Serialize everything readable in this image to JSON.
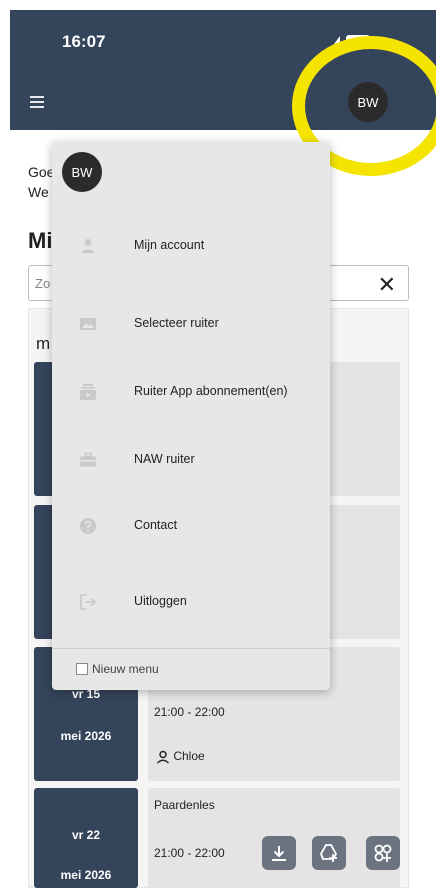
{
  "status_bar": {
    "time": "16:07"
  },
  "header": {
    "avatar_initials": "BW"
  },
  "page": {
    "greeting_line1": "Goe",
    "greeting_line2": "We",
    "title": "Mi",
    "search_placeholder": "Zo",
    "list_header": "m"
  },
  "lessons": [
    {
      "day": "vr 15",
      "month": "mei 2026",
      "title": "",
      "time": "21:00 - 22:00",
      "rider": "Chloe"
    },
    {
      "day": "vr 22",
      "month": "mei 2026",
      "title": "Paardenles",
      "time": "21:00 - 22:00",
      "rider": ""
    }
  ],
  "menu": {
    "avatar_initials": "BW",
    "items": [
      {
        "label": "Mijn account",
        "icon": "person-icon"
      },
      {
        "label": "Selecteer ruiter",
        "icon": "image-icon"
      },
      {
        "label": "Ruiter App abonnement(en)",
        "icon": "subscriptions-icon"
      },
      {
        "label": "NAW ruiter",
        "icon": "briefcase-icon"
      },
      {
        "label": "Contact",
        "icon": "help-icon"
      },
      {
        "label": "Uitloggen",
        "icon": "logout-icon"
      }
    ],
    "footer_label": "Nieuw menu"
  },
  "colors": {
    "appbar": "#34445a",
    "menu_bg": "#e7e7e7",
    "highlight": "#f5e400"
  }
}
